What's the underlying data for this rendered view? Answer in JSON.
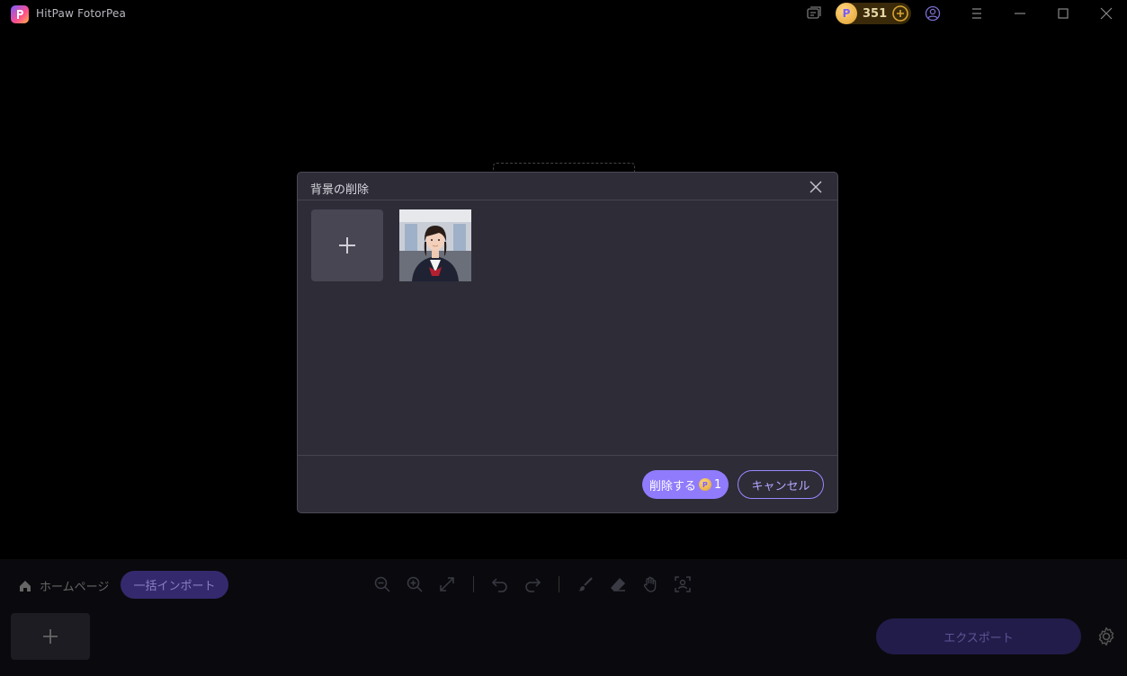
{
  "app": {
    "title": "HitPaw FotorPea"
  },
  "titlebar": {
    "credits": "351",
    "icons": [
      "chat-icon",
      "coin-icon",
      "add-credits-icon",
      "account-icon",
      "menu-icon",
      "minimize-icon",
      "maximize-icon",
      "close-icon"
    ]
  },
  "dialog": {
    "title": "背景の削除",
    "primary_label": "削除する",
    "primary_cost": "1",
    "secondary_label": "キャンセル"
  },
  "bottom": {
    "home_label": "ホームページ",
    "batch_import_label": "一括インポート",
    "export_label": "エクスポート",
    "tools": [
      "zoom-out-icon",
      "zoom-in-icon",
      "fit-icon",
      "undo-icon",
      "redo-icon",
      "brush-icon",
      "eraser-icon",
      "hand-icon",
      "select-subject-icon"
    ]
  },
  "colors": {
    "accent": "#8f7bfc",
    "dialog_bg": "#2d2c37",
    "coin": "#e0a030"
  }
}
